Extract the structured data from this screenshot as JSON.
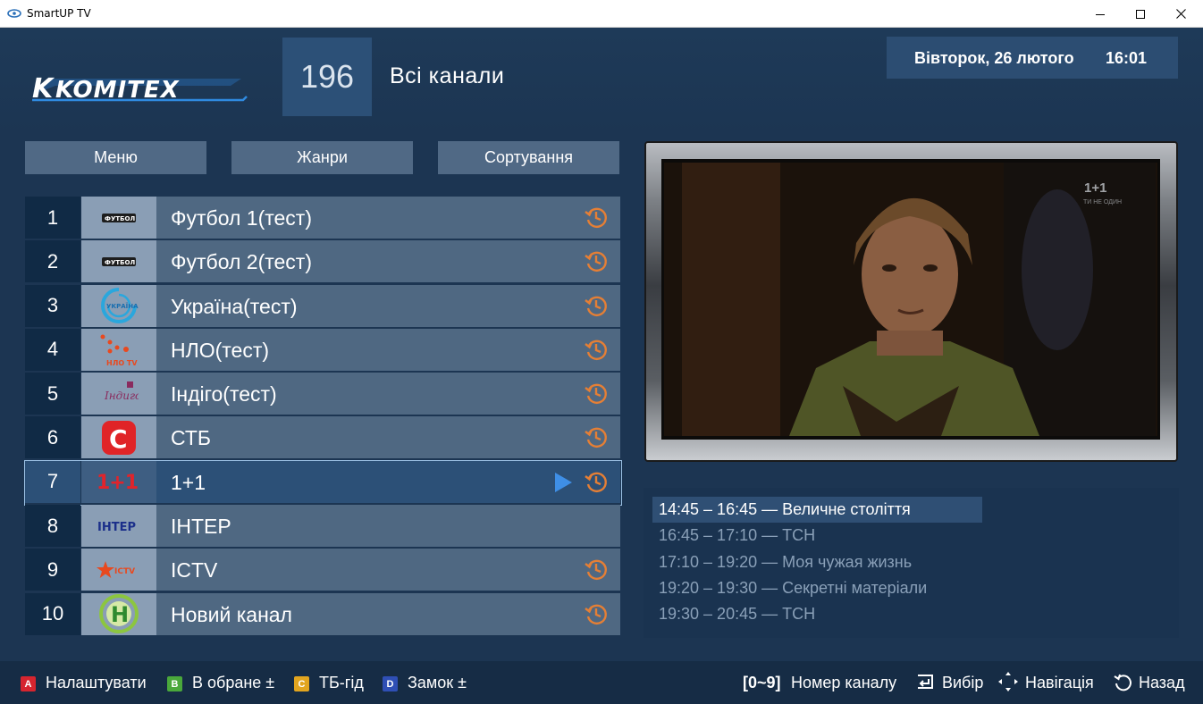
{
  "window": {
    "title": "SmartUP TV"
  },
  "header": {
    "logo_text": "KOMITEX",
    "channel_count": "196",
    "list_title": "Всі канали",
    "date": "Вівторок, 26 лютого",
    "time": "16:01"
  },
  "tabs": [
    {
      "label": "Меню"
    },
    {
      "label": "Жанри"
    },
    {
      "label": "Сортування"
    }
  ],
  "channels": [
    {
      "number": "1",
      "name": "Футбол 1(тест)",
      "logo_text": "ФУТБОЛ 1",
      "logo": "football1-logo",
      "archive": true
    },
    {
      "number": "2",
      "name": "Футбол 2(тест)",
      "logo_text": "ФУТБОЛ 2",
      "logo": "football2-logo",
      "archive": true
    },
    {
      "number": "3",
      "name": "Україна(тест)",
      "logo_text": "УКРАЇНА",
      "logo": "ukraina-logo",
      "archive": true
    },
    {
      "number": "4",
      "name": "НЛО(тест)",
      "logo_text": "НЛО TV",
      "logo": "nlo-logo",
      "archive": true
    },
    {
      "number": "5",
      "name": "Індіго(тест)",
      "logo_text": "Індиго",
      "logo": "indigo-logo",
      "archive": true
    },
    {
      "number": "6",
      "name": "СТБ",
      "logo_text": "C",
      "logo": "stb-logo",
      "archive": true
    },
    {
      "number": "7",
      "name": "1+1",
      "logo_text": "1+1",
      "logo": "1plus1-logo",
      "archive": true,
      "selected": true,
      "playing": true
    },
    {
      "number": "8",
      "name": "ІНТЕР",
      "logo_text": "ІНТЕР",
      "logo": "inter-logo",
      "archive": false
    },
    {
      "number": "9",
      "name": "ICTV",
      "logo_text": "ICTV",
      "logo": "ictv-logo",
      "archive": true
    },
    {
      "number": "10",
      "name": "Новий канал",
      "logo_text": "Н",
      "logo": "novyi-logo",
      "archive": true
    }
  ],
  "preview": {
    "watermark": "1+1",
    "watermark_sub": "ТИ НЕ ОДИН"
  },
  "epg": [
    {
      "text": "14:45 – 16:45  —  Величне століття",
      "current": true
    },
    {
      "text": "16:45 – 17:10  —  ТСН",
      "current": false
    },
    {
      "text": "17:10 – 19:20  —  Моя чужая жизнь",
      "current": false
    },
    {
      "text": "19:20 – 19:30  —  Секретні матеріали",
      "current": false
    },
    {
      "text": "19:30 – 20:45  —  ТСН",
      "current": false
    }
  ],
  "footer": {
    "a_key": "A",
    "a_label": "Налаштувати",
    "b_key": "B",
    "b_label": "В обране ±",
    "c_key": "C",
    "c_label": "ТБ-гід",
    "d_key": "D",
    "d_label": "Замок ±",
    "digits_key": "[0~9]",
    "digits_label": "Номер каналу",
    "select_label": "Вибір",
    "nav_label": "Навігація",
    "back_label": "Назад"
  },
  "colors": {
    "background": "#1c3552",
    "accent_orange": "#e57f35",
    "play_blue": "#3f8fe6",
    "key_red": "#d6252f",
    "key_green": "#4aa83b",
    "key_yellow": "#e2a51f",
    "key_blue": "#2f4fb5"
  }
}
